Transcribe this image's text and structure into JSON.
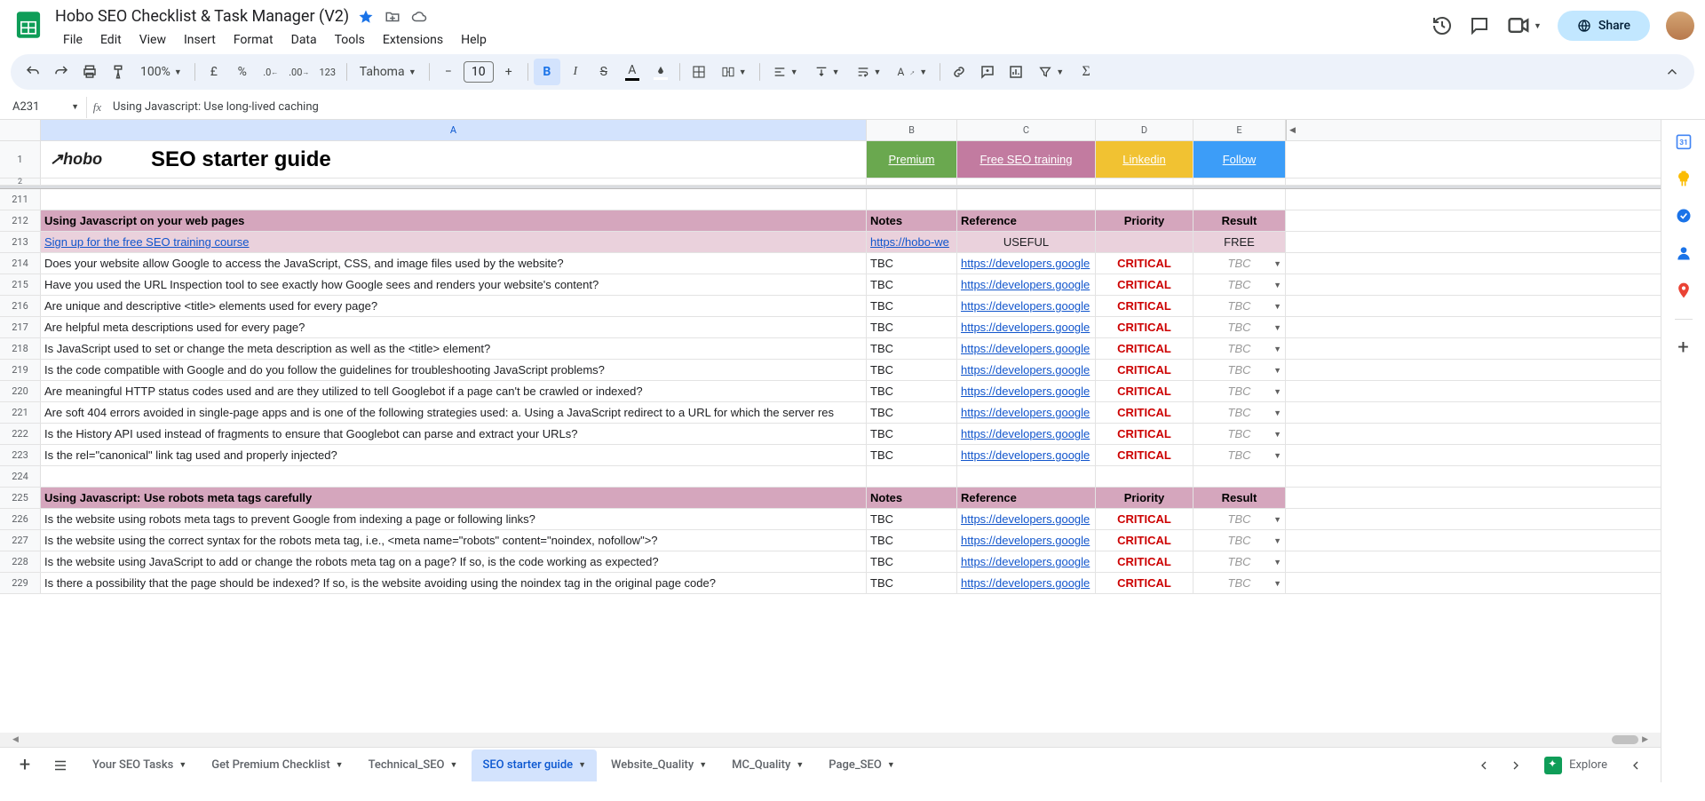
{
  "doc": {
    "title": "Hobo SEO Checklist & Task Manager (V2)"
  },
  "menubar": [
    "File",
    "Edit",
    "View",
    "Insert",
    "Format",
    "Data",
    "Tools",
    "Extensions",
    "Help"
  ],
  "share": "Share",
  "toolbar": {
    "zoom": "100%",
    "currency": "£",
    "pct": "%",
    "num123": "123",
    "font": "Tahoma",
    "size": "10"
  },
  "namebox": "A231",
  "formula": "Using Javascript: Use long-lived caching",
  "columns": [
    "A",
    "B",
    "C",
    "D",
    "E"
  ],
  "frozen": {
    "title": "SEO starter guide",
    "logo": "hobo",
    "links": [
      {
        "label": "Premium",
        "cls": "bg-green"
      },
      {
        "label": "Free SEO training",
        "cls": "bg-pink"
      },
      {
        "label": "Linkedin",
        "cls": "bg-orange"
      },
      {
        "label": "Follow",
        "cls": "bg-blue"
      }
    ]
  },
  "rows": [
    {
      "n": 211,
      "type": "blank"
    },
    {
      "n": 212,
      "type": "section",
      "a": "Using Javascript on your web pages",
      "b": "Notes",
      "c": "Reference",
      "d": "Priority",
      "e": "Result"
    },
    {
      "n": 213,
      "type": "signup",
      "a": "Sign up for the free SEO training course",
      "b": "https://hobo-we",
      "c": "USEFUL",
      "d": "",
      "e": "FREE"
    },
    {
      "n": 214,
      "type": "data",
      "a": "Does your website allow Google to access the JavaScript, CSS, and image files used by the website?",
      "b": "TBC",
      "c": "https://developers.google",
      "d": "CRITICAL",
      "e": "TBC"
    },
    {
      "n": 215,
      "type": "data",
      "a": "Have you used the URL Inspection tool to see exactly how Google sees and renders your website's content?",
      "b": "TBC",
      "c": "https://developers.google",
      "d": "CRITICAL",
      "e": "TBC"
    },
    {
      "n": 216,
      "type": "data",
      "a": "Are unique and descriptive <title> elements used for every page?",
      "b": "TBC",
      "c": "https://developers.google",
      "d": "CRITICAL",
      "e": "TBC"
    },
    {
      "n": 217,
      "type": "data",
      "a": "Are helpful meta descriptions used for every page?",
      "b": "TBC",
      "c": "https://developers.google",
      "d": "CRITICAL",
      "e": "TBC"
    },
    {
      "n": 218,
      "type": "data",
      "a": "Is JavaScript used to set or change the meta description as well as the <title> element?",
      "b": "TBC",
      "c": "https://developers.google",
      "d": "CRITICAL",
      "e": "TBC"
    },
    {
      "n": 219,
      "type": "data",
      "a": "Is the code compatible with Google and do you follow the guidelines for troubleshooting JavaScript problems?",
      "b": "TBC",
      "c": "https://developers.google",
      "d": "CRITICAL",
      "e": "TBC"
    },
    {
      "n": 220,
      "type": "data",
      "a": "Are meaningful HTTP status codes used and are they utilized to tell Googlebot if a page can't be crawled or indexed?",
      "b": "TBC",
      "c": "https://developers.google",
      "d": "CRITICAL",
      "e": "TBC"
    },
    {
      "n": 221,
      "type": "data",
      "a": "Are soft 404 errors avoided in single-page apps and is one of the following strategies used: a. Using a JavaScript redirect to a URL for which the server res",
      "b": "TBC",
      "c": "https://developers.google",
      "d": "CRITICAL",
      "e": "TBC"
    },
    {
      "n": 222,
      "type": "data",
      "a": "Is the History API used instead of fragments to ensure that Googlebot can parse and extract your URLs?",
      "b": "TBC",
      "c": "https://developers.google",
      "d": "CRITICAL",
      "e": "TBC"
    },
    {
      "n": 223,
      "type": "data",
      "a": "Is the rel=\"canonical\" link tag used and properly injected?",
      "b": "TBC",
      "c": "https://developers.google",
      "d": "CRITICAL",
      "e": "TBC"
    },
    {
      "n": 224,
      "type": "blank"
    },
    {
      "n": 225,
      "type": "section",
      "a": "Using Javascript: Use robots meta tags carefully",
      "b": "Notes",
      "c": "Reference",
      "d": "Priority",
      "e": "Result"
    },
    {
      "n": 226,
      "type": "data",
      "a": "Is the website using robots meta tags to prevent Google from indexing a page or following links?",
      "b": "TBC",
      "c": "https://developers.google",
      "d": "CRITICAL",
      "e": "TBC"
    },
    {
      "n": 227,
      "type": "data",
      "a": "Is the website using the correct syntax for the robots meta tag, i.e., <meta name=\"robots\" content=\"noindex, nofollow\">?",
      "b": "TBC",
      "c": "https://developers.google",
      "d": "CRITICAL",
      "e": "TBC"
    },
    {
      "n": 228,
      "type": "data",
      "a": "Is the website using JavaScript to add or change the robots meta tag on a page? If so, is the code working as expected?",
      "b": "TBC",
      "c": "https://developers.google",
      "d": "CRITICAL",
      "e": "TBC"
    },
    {
      "n": 229,
      "type": "data",
      "a": "Is there a possibility that the page should be indexed? If so, is the website avoiding using the noindex tag in the original page code?",
      "b": "TBC",
      "c": "https://developers.google",
      "d": "CRITICAL",
      "e": "TBC"
    }
  ],
  "tabs": [
    {
      "label": "Your SEO Tasks",
      "active": false
    },
    {
      "label": "Get Premium Checklist",
      "active": false
    },
    {
      "label": "Technical_SEO",
      "active": false
    },
    {
      "label": "SEO starter guide",
      "active": true
    },
    {
      "label": "Website_Quality",
      "active": false
    },
    {
      "label": "MC_Quality",
      "active": false
    },
    {
      "label": "Page_SEO",
      "active": false
    }
  ],
  "explore": "Explore"
}
